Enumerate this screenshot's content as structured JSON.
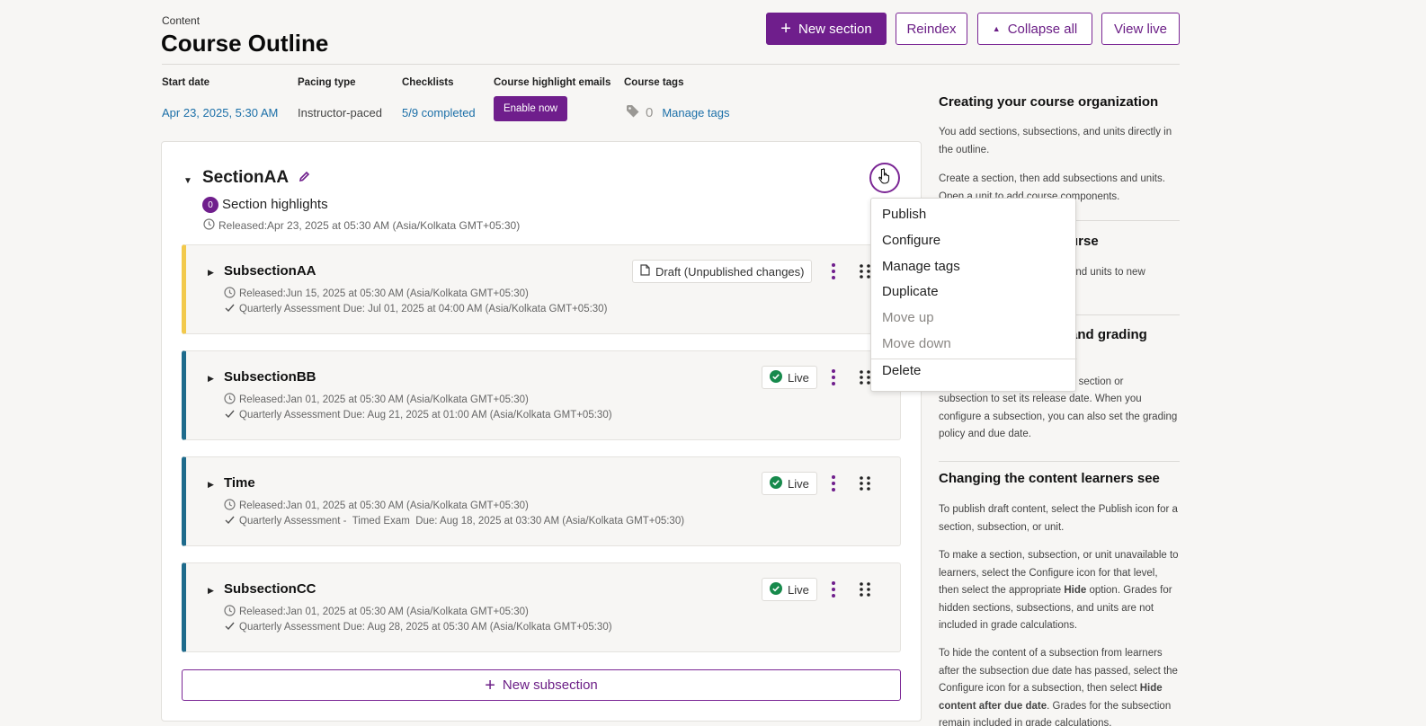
{
  "header": {
    "eyebrow": "Content",
    "title": "Course Outline",
    "buttons": {
      "new_section": "New section",
      "reindex": "Reindex",
      "collapse_all": "Collapse all",
      "view_live": "View live"
    }
  },
  "meta": {
    "start_date_label": "Start date",
    "start_date_value": "Apr 23, 2025, 5:30 AM",
    "pacing_label": "Pacing type",
    "pacing_value": "Instructor-paced",
    "checklists_label": "Checklists",
    "checklists_value": "5/9 completed",
    "highlight_label": "Course highlight emails",
    "highlight_button": "Enable now",
    "tags_label": "Course tags",
    "tags_count": "0",
    "tags_link": "Manage tags"
  },
  "section": {
    "title": "SectionAA",
    "highlights_count": "0",
    "highlights_label": "Section highlights",
    "release": "Released:Apr 23, 2025 at 05:30 AM (Asia/Kolkata GMT+05:30)",
    "subsections": [
      {
        "title": "SubsectionAA",
        "status": "Draft (Unpublished changes)",
        "release": "Released:Jun 15, 2025 at 05:30 AM (Asia/Kolkata GMT+05:30)",
        "due": "Quarterly Assessment Due: Jul 01, 2025 at 04:00 AM (Asia/Kolkata GMT+05:30)"
      },
      {
        "title": "SubsectionBB",
        "status": "Live",
        "release": "Released:Jan 01, 2025 at 05:30 AM (Asia/Kolkata GMT+05:30)",
        "due": "Quarterly Assessment Due: Aug 21, 2025 at 01:00 AM (Asia/Kolkata GMT+05:30)"
      },
      {
        "title": "Time",
        "status": "Live",
        "release": "Released:Jan 01, 2025 at 05:30 AM (Asia/Kolkata GMT+05:30)",
        "due": "Quarterly Assessment -  Timed Exam  Due: Aug 18, 2025 at 03:30 AM (Asia/Kolkata GMT+05:30)"
      },
      {
        "title": "SubsectionCC",
        "status": "Live",
        "release": "Released:Jan 01, 2025 at 05:30 AM (Asia/Kolkata GMT+05:30)",
        "due": "Quarterly Assessment Due: Aug 28, 2025 at 05:30 AM (Asia/Kolkata GMT+05:30)"
      }
    ],
    "new_subsection": "New subsection"
  },
  "menu": {
    "items": [
      "Publish",
      "Configure",
      "Manage tags",
      "Duplicate",
      "Move up",
      "Move down",
      "Delete"
    ]
  },
  "sidebar": {
    "h1": "Creating your course organization",
    "p1": "You add sections, subsections, and units directly in the outline.",
    "p2": "Create a section, then add subsections and units. Open a unit to add course components.",
    "h2_tail": "urse",
    "p3_tail": "and units to new",
    "h3_tail": "and grading",
    "p4_tail": "a section or",
    "p4b": "subsection to set its release date. When you configure a subsection, you can also set the grading policy and due date.",
    "h4": "Changing the content learners see",
    "p5": "To publish draft content, select the Publish icon for a section, subsection, or unit.",
    "p6_pre": "To make a section, subsection, or unit unavailable to learners, select the Configure icon for that level, then select the appropriate ",
    "p6_bold": "Hide",
    "p6_post": " option. Grades for hidden sections, subsections, and units are not included in grade calculations.",
    "p7_pre": "To hide the content of a subsection from learners after the subsection due date has passed, select the Configure icon for a subsection, then select ",
    "p7_bold": "Hide content after due date",
    "p7_post": ". Grades for the subsection remain included in grade calculations."
  },
  "colors": {
    "brand": "#6f1e8c",
    "link": "#1b6fa8",
    "live_green": "#178a4c",
    "draft_yellow": "#f2c94c",
    "published_blue": "#1e6b8c"
  }
}
